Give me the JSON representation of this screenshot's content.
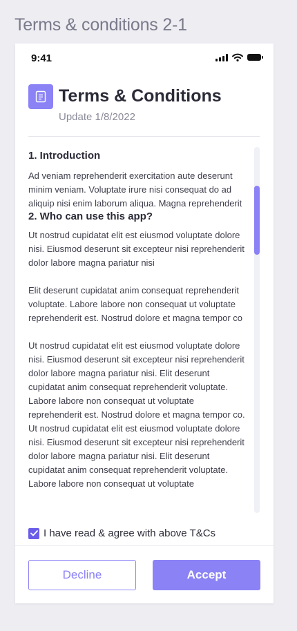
{
  "frame": {
    "title": "Terms & conditions 2-1"
  },
  "status_bar": {
    "time": "9:41",
    "icons": [
      "signal-icon",
      "wifi-icon",
      "battery-icon"
    ]
  },
  "header": {
    "icon": "document-icon",
    "title": "Terms & Conditions",
    "updated": "Update 1/8/2022"
  },
  "content": {
    "sections": [
      {
        "title": "1. Introduction",
        "paragraphs": [
          "Ad veniam reprehenderit exercitation aute deserunt minim veniam. Voluptate irure nisi consequat do ad aliquip nisi enim laborum aliqua. Magna reprehenderit"
        ]
      },
      {
        "title": "2. Who can use this app?",
        "paragraphs": [
          "Ut nostrud cupidatat elit est eiusmod voluptate dolore nisi. Eiusmod deserunt sit excepteur nisi reprehenderit dolor labore magna pariatur nisi",
          "Elit deserunt cupidatat anim consequat reprehenderit voluptate. Labore labore non consequat ut voluptate reprehenderit est. Nostrud dolore et magna tempor co",
          "Ut nostrud cupidatat elit est eiusmod voluptate dolore nisi. Eiusmod deserunt sit excepteur nisi reprehenderit dolor labore magna pariatur nisi. Elit deserunt cupidatat anim consequat reprehenderit voluptate. Labore labore non consequat ut voluptate reprehenderit est. Nostrud dolore et magna tempor co. Ut nostrud cupidatat elit est eiusmod voluptate dolore nisi. Eiusmod deserunt sit excepteur nisi reprehenderit dolor labore magna pariatur nisi. Elit deserunt cupidatat anim consequat reprehenderit voluptate. Labore labore non consequat ut voluptate"
        ]
      }
    ]
  },
  "agreement": {
    "checked": true,
    "label": "I have read & agree with above T&Cs"
  },
  "actions": {
    "decline_label": "Decline",
    "accept_label": "Accept"
  },
  "colors": {
    "accent": "#8b82f6",
    "checkbox": "#6a5ce8",
    "background": "#ededf2"
  }
}
